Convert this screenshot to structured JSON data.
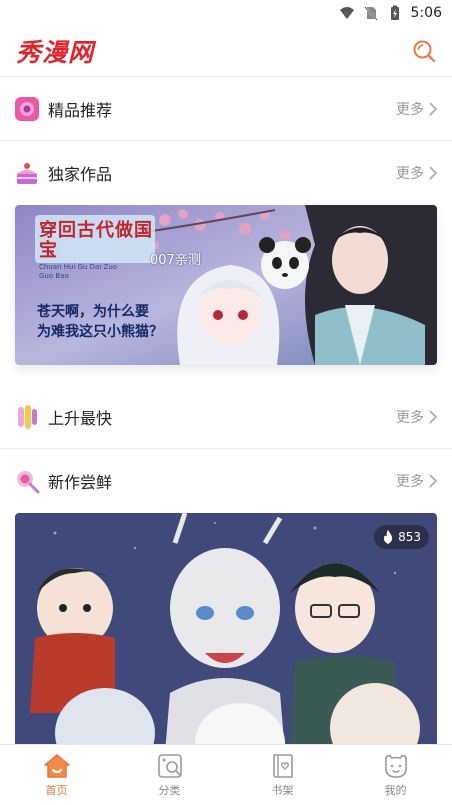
{
  "status": {
    "time": "5:06",
    "icons": [
      "wifi-icon",
      "no-sim-icon",
      "battery-icon"
    ]
  },
  "app": {
    "logo_text": "秀漫网",
    "search_icon": "search-icon",
    "accent": "#e8773a"
  },
  "sections": [
    {
      "title": "精品推荐",
      "more": "更多",
      "icon": "gem-icon"
    },
    {
      "title": "独家作品",
      "more": "更多",
      "icon": "cake-icon"
    },
    {
      "title": "上升最快",
      "more": "更多",
      "icon": "rocket-icon"
    },
    {
      "title": "新作尝鲜",
      "more": "更多",
      "icon": "lollipop-icon"
    }
  ],
  "banner1": {
    "title": "穿回古代做国宝",
    "subtitle": "Chuan Hui Gu Dai Zuo Guo Bao",
    "tag": "007亲测",
    "caption_line1": "苍天啊，为什么要",
    "caption_line2": "为难我这只小熊猫？"
  },
  "banner2": {
    "hot_count": "853",
    "hot_icon": "fire-icon"
  },
  "tabs": [
    {
      "label": "首页",
      "icon": "home-icon",
      "active": true
    },
    {
      "label": "分类",
      "icon": "category-icon",
      "active": false
    },
    {
      "label": "书架",
      "icon": "bookshelf-icon",
      "active": false
    },
    {
      "label": "我的",
      "icon": "profile-icon",
      "active": false
    }
  ]
}
